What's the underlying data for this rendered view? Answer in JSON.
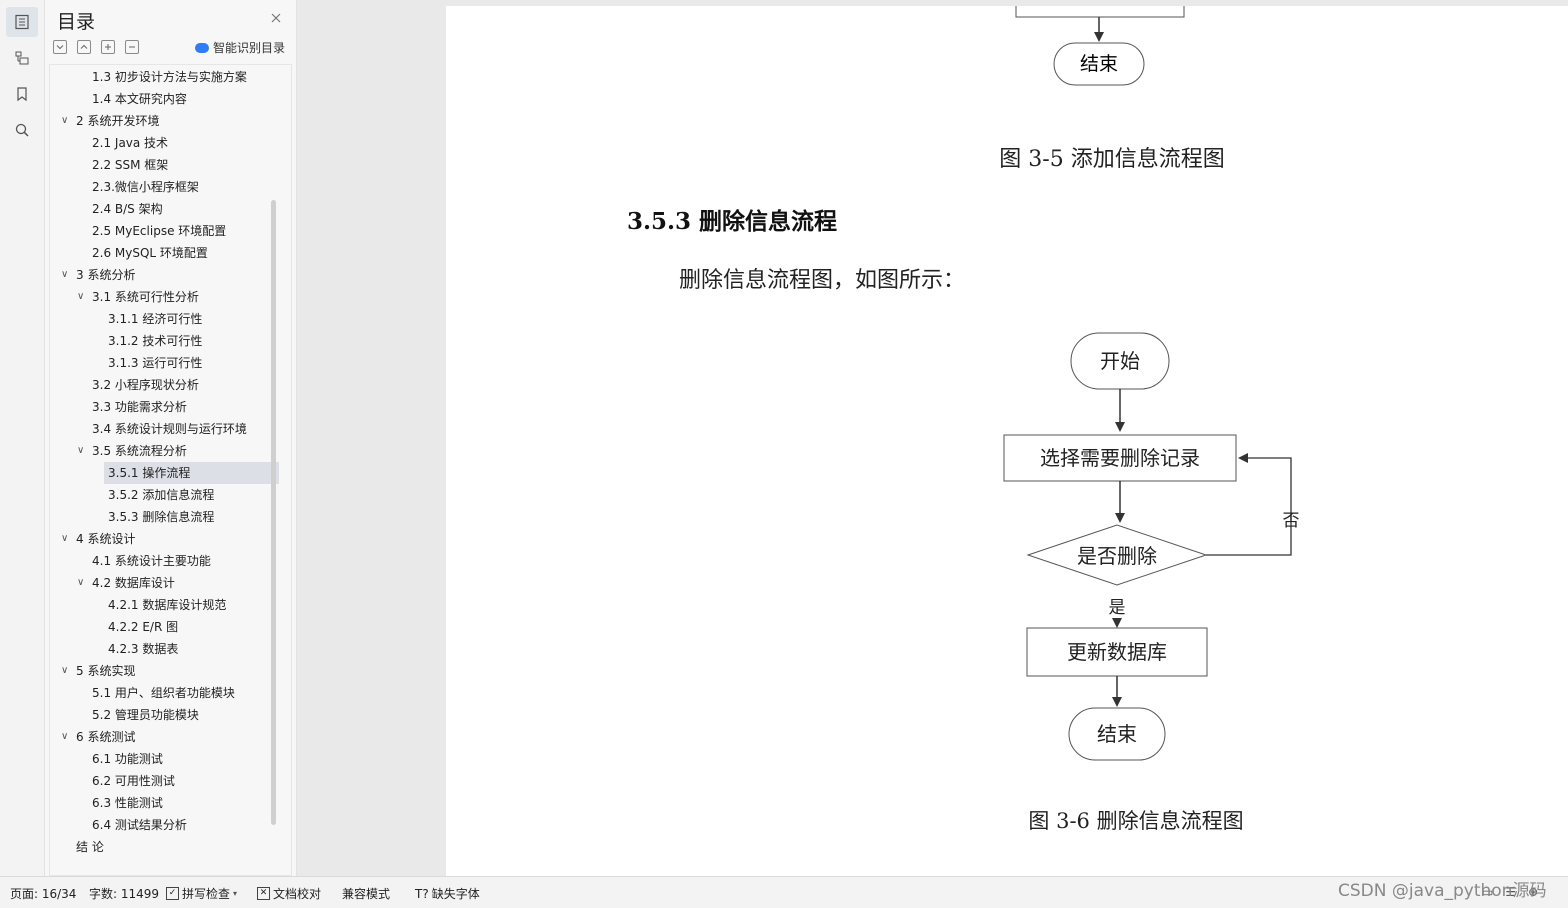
{
  "toc": {
    "title": "目录",
    "smart_label": "智能识别目录",
    "items": [
      {
        "label": "1.3  初步设计方法与实施方案",
        "level": 1,
        "chevron": false,
        "selected": false
      },
      {
        "label": "1.4  本文研究内容",
        "level": 1,
        "chevron": false,
        "selected": false
      },
      {
        "label": "2  系统开发环境",
        "level": 0,
        "chevron": true,
        "selected": false
      },
      {
        "label": "2.1 Java 技术",
        "level": 1,
        "chevron": false,
        "selected": false
      },
      {
        "label": "2.2 SSM 框架",
        "level": 1,
        "chevron": false,
        "selected": false
      },
      {
        "label": "2.3.微信小程序框架",
        "level": 1,
        "chevron": false,
        "selected": false
      },
      {
        "label": "2.4 B/S 架构",
        "level": 1,
        "chevron": false,
        "selected": false
      },
      {
        "label": "2.5 MyEclipse 环境配置",
        "level": 1,
        "chevron": false,
        "selected": false
      },
      {
        "label": "2.6 MySQL 环境配置",
        "level": 1,
        "chevron": false,
        "selected": false
      },
      {
        "label": "3  系统分析",
        "level": 0,
        "chevron": true,
        "selected": false
      },
      {
        "label": "3.1  系统可行性分析",
        "level": 1,
        "chevron": true,
        "selected": false
      },
      {
        "label": "3.1.1  经济可行性",
        "level": 2,
        "chevron": false,
        "selected": false
      },
      {
        "label": "3.1.2  技术可行性",
        "level": 2,
        "chevron": false,
        "selected": false
      },
      {
        "label": "3.1.3  运行可行性",
        "level": 2,
        "chevron": false,
        "selected": false
      },
      {
        "label": "3.2  小程序现状分析",
        "level": 1,
        "chevron": false,
        "selected": false
      },
      {
        "label": "3.3  功能需求分析",
        "level": 1,
        "chevron": false,
        "selected": false
      },
      {
        "label": "3.4  系统设计规则与运行环境",
        "level": 1,
        "chevron": false,
        "selected": false
      },
      {
        "label": "3.5 系统流程分析",
        "level": 1,
        "chevron": true,
        "selected": false
      },
      {
        "label": "3.5.1 操作流程",
        "level": 2,
        "chevron": false,
        "selected": true
      },
      {
        "label": "3.5.2 添加信息流程",
        "level": 2,
        "chevron": false,
        "selected": false
      },
      {
        "label": "3.5.3 删除信息流程",
        "level": 2,
        "chevron": false,
        "selected": false
      },
      {
        "label": "4  系统设计",
        "level": 0,
        "chevron": true,
        "selected": false
      },
      {
        "label": "4.1  系统设计主要功能",
        "level": 1,
        "chevron": false,
        "selected": false
      },
      {
        "label": "4.2  数据库设计",
        "level": 1,
        "chevron": true,
        "selected": false
      },
      {
        "label": "4.2.1  数据库设计规范",
        "level": 2,
        "chevron": false,
        "selected": false
      },
      {
        "label": "4.2.2    E/R 图",
        "level": 2,
        "chevron": false,
        "selected": false
      },
      {
        "label": "4.2.3  数据表",
        "level": 2,
        "chevron": false,
        "selected": false
      },
      {
        "label": "5  系统实现",
        "level": 0,
        "chevron": true,
        "selected": false
      },
      {
        "label": "5.1 用户、组织者功能模块",
        "level": 1,
        "chevron": false,
        "selected": false
      },
      {
        "label": "5.2 管理员功能模块",
        "level": 1,
        "chevron": false,
        "selected": false
      },
      {
        "label": "6  系统测试",
        "level": 0,
        "chevron": true,
        "selected": false
      },
      {
        "label": "6.1  功能测试",
        "level": 1,
        "chevron": false,
        "selected": false
      },
      {
        "label": "6.2  可用性测试",
        "level": 1,
        "chevron": false,
        "selected": false
      },
      {
        "label": "6.3  性能测试",
        "level": 1,
        "chevron": false,
        "selected": false
      },
      {
        "label": "6.4  测试结果分析",
        "level": 1,
        "chevron": false,
        "selected": false
      },
      {
        "label": "结  论",
        "level": 0,
        "chevron": false,
        "selected": false
      }
    ]
  },
  "document": {
    "prev_flow_end": "结束",
    "fig35_caption": "图 3-5 添加信息流程图",
    "section_heading": "3.5.3 删除信息流程",
    "paragraph": "删除信息流程图，如图所示：",
    "flow": {
      "start": "开始",
      "select": "选择需要删除记录",
      "decision": "是否删除",
      "no_label": "否",
      "yes_label": "是",
      "update": "更新数据库",
      "end": "结束"
    },
    "fig36_caption": "图 3-6 删除信息流程图"
  },
  "status": {
    "page": "页面: 16/34",
    "words": "字数: 11499",
    "spell": "拼写检查",
    "proof": "文档校对",
    "compat": "兼容模式",
    "missing_font": "缺失字体"
  },
  "watermark": "CSDN @java_python源码",
  "colors": {
    "accent": "#2f7cf6",
    "selected_bg": "#dcdfe6",
    "flow_border": "#555555"
  }
}
